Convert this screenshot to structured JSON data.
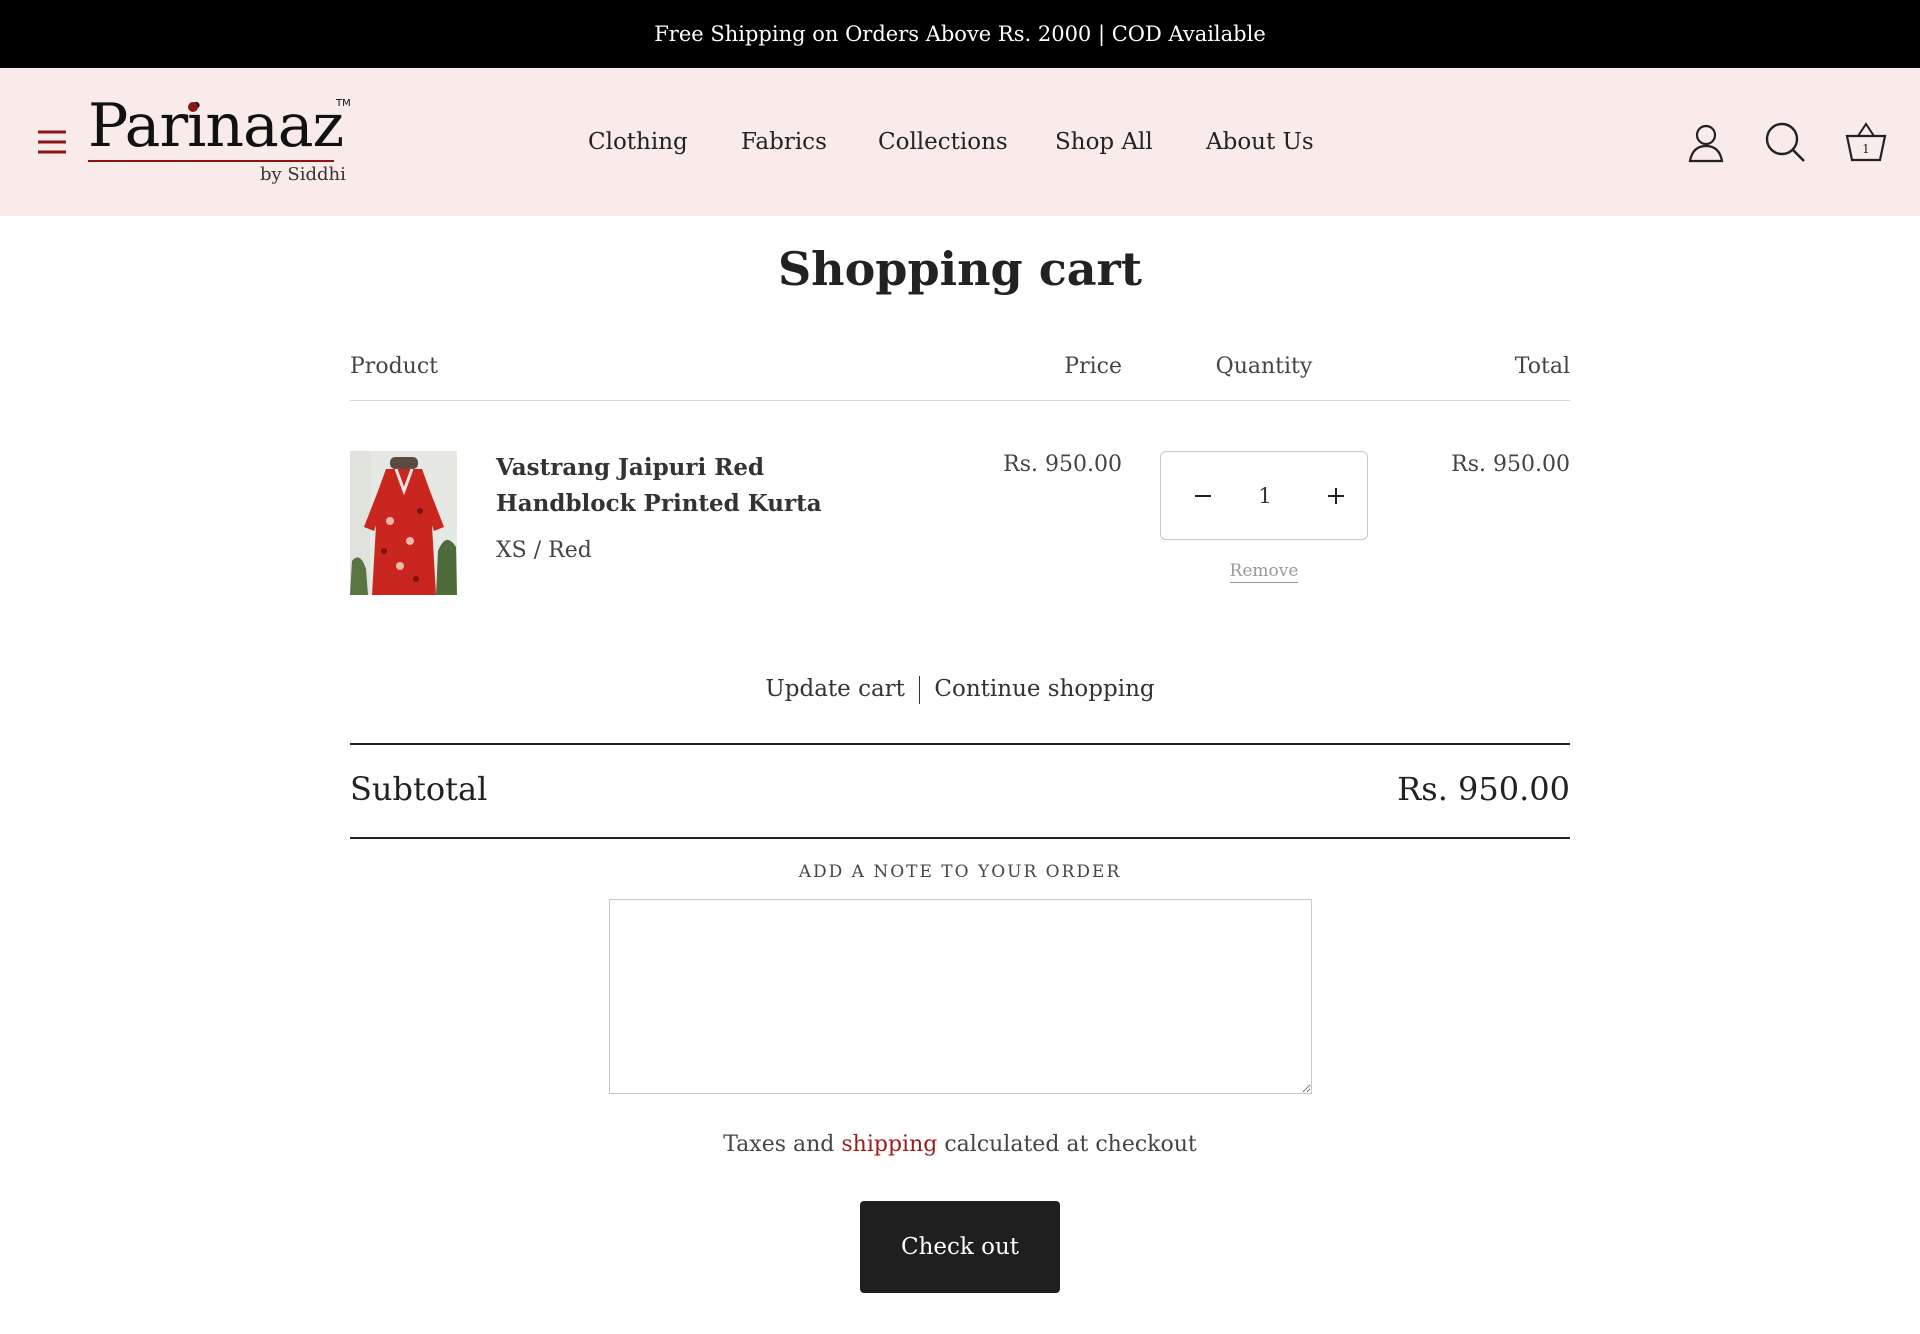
{
  "announcement": "Free Shipping on Orders Above Rs. 2000 | COD Available",
  "brand": {
    "name": "Parinaaz",
    "tm": "TM",
    "tagline": "by Siddhi",
    "accent": "#8c1515",
    "header_bg": "#f9ebea"
  },
  "nav": {
    "items": [
      "Clothing",
      "Fabrics",
      "Collections",
      "Shop All",
      "About Us"
    ]
  },
  "header_icons": {
    "menu": "hamburger-icon",
    "account": "user-icon",
    "search": "search-icon",
    "cart": "basket-icon",
    "cart_count": "1"
  },
  "page": {
    "title": "Shopping cart"
  },
  "columns": {
    "product": "Product",
    "price": "Price",
    "quantity": "Quantity",
    "total": "Total"
  },
  "cart": {
    "items": [
      {
        "name": "Vastrang Jaipuri Red Handblock Printed Kurta",
        "variant": "XS / Red",
        "price": "Rs. 950.00",
        "quantity": "1",
        "total": "Rs. 950.00",
        "remove_label": "Remove"
      }
    ]
  },
  "actions": {
    "update": "Update cart",
    "continue": "Continue shopping"
  },
  "summary": {
    "subtotal_label": "Subtotal",
    "subtotal_value": "Rs. 950.00"
  },
  "note": {
    "label": "ADD A NOTE TO YOUR ORDER",
    "value": ""
  },
  "taxes": {
    "before": "Taxes and",
    "link": "shipping",
    "after": "calculated at checkout"
  },
  "checkout": {
    "label": "Check out",
    "bg": "#1f1f1f"
  }
}
